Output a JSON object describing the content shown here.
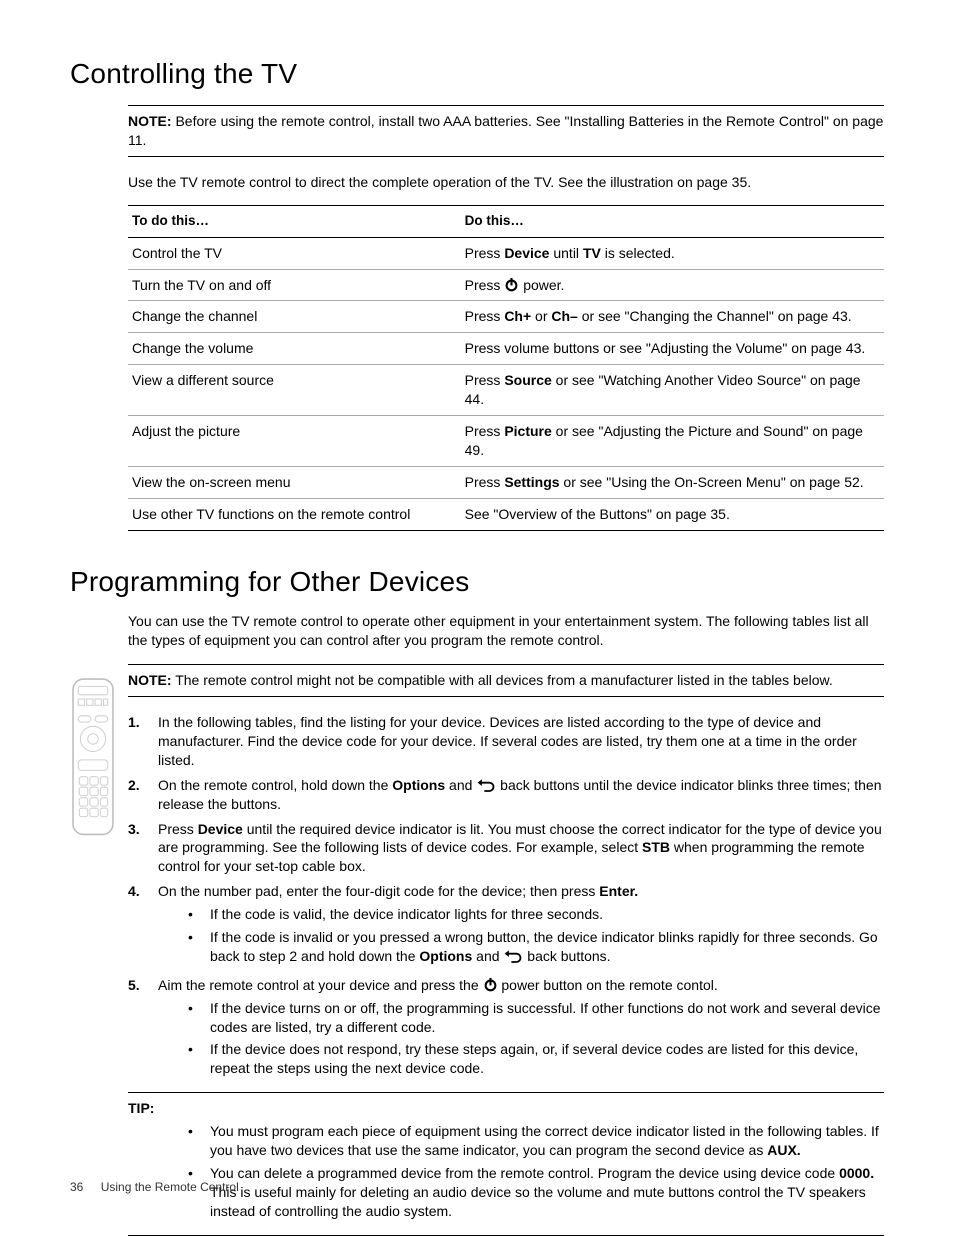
{
  "section1": {
    "title": "Controlling the TV",
    "note_label": "NOTE:",
    "note_text": "Before using the remote control, install two AAA batteries. See \"Installing Batteries in the Remote Control\" on page 11.",
    "intro": "Use the TV remote control to direct the complete operation of the TV. See the illustration on page 35.",
    "th1": "To do this…",
    "th2": "Do this…",
    "rows": [
      {
        "c1": "Control the TV",
        "c2_pre": "Press ",
        "c2_b1": "Device",
        "c2_mid": " until ",
        "c2_b2": "TV",
        "c2_post": " is selected."
      },
      {
        "c1": "Turn the TV on and off",
        "c2_pre": "Press ",
        "icon": "power",
        "c2_post": " power."
      },
      {
        "c1": "Change the channel",
        "c2_pre": "Press ",
        "c2_b1": "Ch+",
        "c2_mid": " or ",
        "c2_b2": "Ch–",
        "c2_post": " or see \"Changing the Channel\" on page 43."
      },
      {
        "c1": "Change the volume",
        "c2_pre": "Press volume buttons or see \"Adjusting the Volume\" on page 43."
      },
      {
        "c1": "View a different source",
        "c2_pre": "Press ",
        "c2_b1": "Source",
        "c2_post": " or see \"Watching Another Video Source\" on page 44."
      },
      {
        "c1": "Adjust the picture",
        "c2_pre": "Press ",
        "c2_b1": "Picture",
        "c2_post": " or see \"Adjusting the Picture and Sound\" on page 49."
      },
      {
        "c1": "View the on-screen menu",
        "c2_pre": "Press ",
        "c2_b1": "Settings",
        "c2_post": " or see \"Using the On-Screen Menu\" on page 52."
      },
      {
        "c1": "Use other TV functions on the remote control",
        "c2_pre": "See \"Overview of the Buttons\" on page 35."
      }
    ]
  },
  "section2": {
    "title": "Programming for Other Devices",
    "intro": "You can use the TV remote control to operate other equipment in your entertainment system. The following tables list all the types of equipment you can control after you program the remote control.",
    "note_label": "NOTE:",
    "note_text": "The remote control might not be compatible with all devices from a manufacturer listed in the tables below.",
    "steps": [
      {
        "n": "1.",
        "t": "In the following tables, find the listing for your device. Devices are listed according to the type of device and manufacturer. Find the device code for your device. If several codes are listed, try them one at a time in the order listed."
      },
      {
        "n": "2.",
        "pre": "On the remote control, hold down the ",
        "b1": "Options",
        "mid": " and ",
        "icon": "back",
        "post": " back buttons until the device indicator blinks three times; then release the buttons."
      },
      {
        "n": "3.",
        "pre": "Press ",
        "b1": "Device",
        "mid": " until the required device indicator is lit. You must choose the correct indicator for the type of device you are programming. See the following lists of device codes. For example, select ",
        "b2": "STB",
        "post": " when programming the remote control for your set-top cable box."
      },
      {
        "n": "4.",
        "pre": "On the number pad, enter the four-digit code for the device; then press ",
        "b1": "Enter.",
        "bullets": [
          {
            "t": "If the code is valid, the device indicator lights for three seconds."
          },
          {
            "pre": "If the code is invalid or you pressed a wrong button, the device indicator blinks rapidly for three seconds. Go back to step 2 and hold down the ",
            "b1": "Options",
            "mid": " and ",
            "icon": "back",
            "post": " back buttons."
          }
        ]
      },
      {
        "n": "5.",
        "pre": "Aim the remote control at your device and press the ",
        "icon": "power",
        "post": " power button on the remote contol.",
        "bullets": [
          {
            "t": "If the device turns on or off, the programming is successful. If other functions do not work and several device codes are listed, try a different code."
          },
          {
            "t": "If the device does not respond, try these steps again, or, if several device codes are listed for this device, repeat the steps using the next device code."
          }
        ]
      }
    ],
    "tip_label": "TIP:",
    "tips": [
      {
        "pre": "You must program each piece of equipment using the correct device indicator listed in the following tables. If you have two devices that use the same indicator, you can program the second device as ",
        "b1": "AUX."
      },
      {
        "pre": "You can delete a programmed device from the remote control. Program the device using device code ",
        "b1": "0000.",
        "post": " This is useful mainly for deleting an audio device so the volume and mute buttons control the TV speakers instead of controlling the audio system."
      }
    ]
  },
  "footer": {
    "page": "36",
    "title": "Using the Remote Control"
  }
}
